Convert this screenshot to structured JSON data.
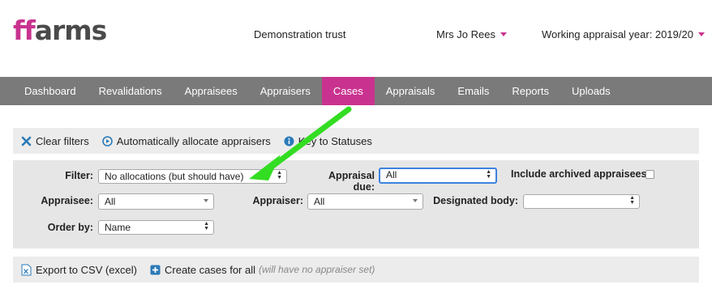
{
  "header": {
    "logo_ff": "ff",
    "logo_rest": "arms",
    "organisation": "Demonstration trust",
    "user_name": "Mrs Jo Rees",
    "appraisal_year": "Working appraisal year: 2019/20"
  },
  "nav": {
    "items": [
      {
        "label": "Dashboard"
      },
      {
        "label": "Revalidations"
      },
      {
        "label": "Appraisees"
      },
      {
        "label": "Appraisers"
      },
      {
        "label": "Cases"
      },
      {
        "label": "Appraisals"
      },
      {
        "label": "Emails"
      },
      {
        "label": "Reports"
      },
      {
        "label": "Uploads"
      }
    ],
    "active": "Cases"
  },
  "actions": {
    "clear_filters": "Clear filters",
    "auto_allocate": "Automatically allocate appraisers",
    "key_to_statuses": "Key to Statuses"
  },
  "filters": {
    "filter_label": "Filter:",
    "filter_value": "No allocations (but should have)",
    "appraisal_due_label": "Appraisal due:",
    "appraisal_due_value": "All",
    "include_archived_label": "Include archived appraisees:",
    "include_archived_checked": false,
    "appraisee_label": "Appraisee:",
    "appraisee_value": "All",
    "appraiser_label": "Appraiser:",
    "appraiser_value": "All",
    "designated_body_label": "Designated body:",
    "designated_body_value": "",
    "order_by_label": "Order by:",
    "order_by_value": "Name"
  },
  "export": {
    "csv_label": "Export to CSV (excel)",
    "create_cases_label": "Create cases for all",
    "create_cases_hint": "(will have no appraiser set)"
  },
  "colors": {
    "brand": "#c9338f",
    "nav_bg": "#7a7a7a",
    "icon_blue": "#2a7ab8",
    "annotation_arrow": "#33dd22"
  }
}
